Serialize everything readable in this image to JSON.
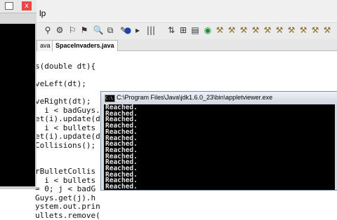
{
  "ide": {
    "menu_partial": "lp",
    "tabs": [
      {
        "label": "ava"
      },
      {
        "label": "SpaceInvaders.java"
      }
    ],
    "code_lines": [
      "s(double dt){",
      "",
      "veLeft(dt);",
      "",
      "veRight(dt);",
      "  i < badGuys.",
      "et(i).update(d",
      "  i < bullets",
      "et(i).update(d",
      "Collisions();",
      "",
      "",
      "rBulletCollis",
      "  i < bullets",
      "= 0; j < badG",
      "Guys.get(j).h",
      "ystem.out.prin",
      "ullets.remove("
    ]
  },
  "left_window": {
    "close_label": "x"
  },
  "console": {
    "title": "C:\\Program Files\\Java\\jdk1.6.0_23\\bin\\appletviewer.exe",
    "icon_text": "C:\\",
    "output_lines": [
      "Reached.",
      "Reached.",
      "Reached.",
      "Reached.",
      "Reached.",
      "Reached.",
      "Reached.",
      "Reached.",
      "Reached.",
      "Reached.",
      "Reached.",
      "Reached.",
      "Reached.",
      "Reached."
    ]
  }
}
